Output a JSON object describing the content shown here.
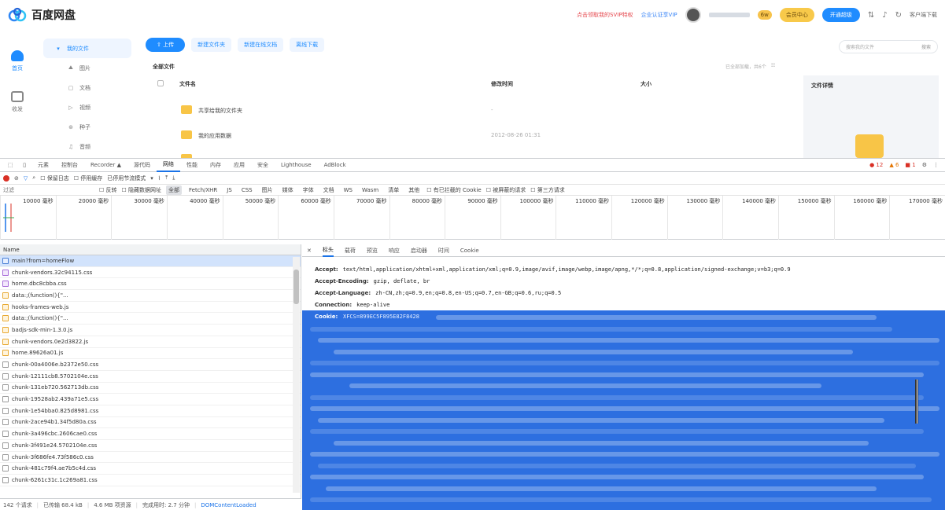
{
  "app": {
    "brand": "百度网盘",
    "promo_red": "点击领取我的SVIP特权",
    "promo_blue": "企业认证享VIP",
    "svip_level": "6w",
    "member_center": "会员中心",
    "pay_button": "开通超级",
    "client_download": "客户端下载",
    "left_nav": [
      {
        "label": "首页",
        "icon": "cloud-home-icon"
      },
      {
        "label": "收发",
        "icon": "inbox-icon"
      }
    ],
    "sub_nav": [
      {
        "label": "我的文件",
        "glyph": "▾",
        "icon": "folder-icon"
      },
      {
        "label": "图片",
        "glyph": "⛰",
        "icon": "image-icon"
      },
      {
        "label": "文档",
        "glyph": "▢",
        "icon": "document-icon"
      },
      {
        "label": "视频",
        "glyph": "▷",
        "icon": "video-icon"
      },
      {
        "label": "种子",
        "glyph": "⊛",
        "icon": "torrent-icon"
      },
      {
        "label": "音频",
        "glyph": "♫",
        "icon": "audio-icon"
      }
    ],
    "toolbar": {
      "upload": "⇧ 上传",
      "new_folder": "新建文件夹",
      "new_online_doc": "新建在线文档",
      "offline_download": "离线下载"
    },
    "search_placeholder": "搜索我的文件",
    "search_button": "搜索",
    "breadcrumb": "全部文件",
    "loaded_info": "已全部加载，共6个",
    "columns": {
      "name": "文件名",
      "modified": "修改时间",
      "size": "大小"
    },
    "files": [
      {
        "name": "共享给我的文件夹",
        "modified": "-"
      },
      {
        "name": "我的应用数据",
        "modified": "2012-08-26 01:31"
      }
    ],
    "detail_title": "文件详情"
  },
  "devtools": {
    "panel_tabs": [
      "元素",
      "控制台",
      "Recorder ▲",
      "源代码",
      "网络",
      "性能",
      "内存",
      "应用",
      "安全",
      "Lighthouse",
      "AdBlock"
    ],
    "active_tab": "网络",
    "errors": "12",
    "warnings": "6",
    "issues": "1",
    "net_toolbar": {
      "preserve_log": "保留日志",
      "disable_cache": "停用缓存",
      "throttle": "已停用节流模式"
    },
    "filter_placeholder": "过滤",
    "filter_types": [
      "反转",
      "隐藏数据网址",
      "全部",
      "Fetch/XHR",
      "JS",
      "CSS",
      "图片",
      "媒体",
      "字体",
      "文档",
      "WS",
      "Wasm",
      "清单",
      "其他"
    ],
    "filter_extra": [
      "有已拦截的 Cookie",
      "被屏蔽的请求",
      "第三方请求"
    ],
    "timeline_ticks": [
      "10000 毫秒",
      "20000 毫秒",
      "30000 毫秒",
      "40000 毫秒",
      "50000 毫秒",
      "60000 毫秒",
      "70000 毫秒",
      "80000 毫秒",
      "90000 毫秒",
      "100000 毫秒",
      "110000 毫秒",
      "120000 毫秒",
      "130000 毫秒",
      "140000 毫秒",
      "150000 毫秒",
      "160000 毫秒",
      "170000 毫秒"
    ],
    "name_column": "Name",
    "requests": [
      {
        "name": "main?from=homeFlow",
        "type": "doc",
        "selected": true
      },
      {
        "name": "chunk-vendors.32c94115.css",
        "type": "css"
      },
      {
        "name": "home.dbc8cbba.css",
        "type": "css"
      },
      {
        "name": "data:;(function(){\"...",
        "type": "data"
      },
      {
        "name": "hooks-frames-web.js",
        "type": "js"
      },
      {
        "name": "data:;(function(){\"...",
        "type": "data"
      },
      {
        "name": "badjs-sdk-min-1.3.0.js",
        "type": "js"
      },
      {
        "name": "chunk-vendors.0e2d3822.js",
        "type": "js"
      },
      {
        "name": "home.89626a01.js",
        "type": "js"
      },
      {
        "name": "chunk-00a4006e.b2372e50.css",
        "type": "plain"
      },
      {
        "name": "chunk-12111cb8.5702104e.css",
        "type": "plain"
      },
      {
        "name": "chunk-131eb720.562713db.css",
        "type": "plain"
      },
      {
        "name": "chunk-19528ab2.439a71e5.css",
        "type": "plain"
      },
      {
        "name": "chunk-1e54bba0.825d8981.css",
        "type": "plain"
      },
      {
        "name": "chunk-2ace94b1.34f5d80a.css",
        "type": "plain"
      },
      {
        "name": "chunk-3a496cbc.2606cae0.css",
        "type": "plain"
      },
      {
        "name": "chunk-3f491e24.5702104e.css",
        "type": "plain"
      },
      {
        "name": "chunk-3f686fe4.73f586c0.css",
        "type": "plain"
      },
      {
        "name": "chunk-481c79f4.ae7b5c4d.css",
        "type": "plain"
      },
      {
        "name": "chunk-6261c31c.1c269a81.css",
        "type": "plain"
      }
    ],
    "status": {
      "requests": "142 个请求",
      "transferred": "已传输 68.4 kB",
      "resources": "4.6 MB 项资源",
      "finish": "完成用时: 2.7 分钟",
      "dcl": "DOMContentLoaded"
    },
    "detail_tabs": [
      "标头",
      "载荷",
      "预览",
      "响应",
      "启动器",
      "时间",
      "Cookie"
    ],
    "headers": [
      {
        "key": "Accept:",
        "value": "text/html,application/xhtml+xml,application/xml;q=0.9,image/avif,image/webp,image/apng,*/*;q=0.8,application/signed-exchange;v=b3;q=0.9"
      },
      {
        "key": "Accept-Encoding:",
        "value": "gzip, deflate, br"
      },
      {
        "key": "Accept-Language:",
        "value": "zh-CN,zh;q=0.9,en;q=0.8,en-US;q=0.7,en-GB;q=0.6,ru;q=0.5"
      },
      {
        "key": "Connection:",
        "value": "keep-alive"
      }
    ],
    "cookie_label": "Cookie:",
    "cookie_value": "XFCS=899EC5F895E82F8428"
  }
}
